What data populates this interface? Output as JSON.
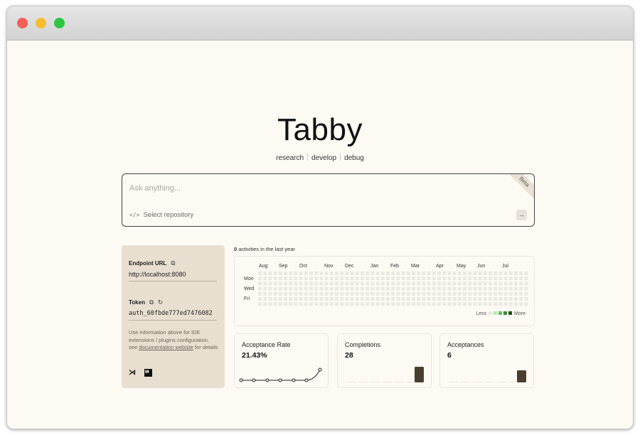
{
  "app": {
    "title": "Tabby"
  },
  "tagline": [
    "research",
    "develop",
    "debug"
  ],
  "ask": {
    "placeholder": "Ask anything...",
    "badge": "Beta",
    "repo_label": "Select repository"
  },
  "connection": {
    "endpoint_label": "Endpoint URL",
    "endpoint_value": "http://localhost:8080",
    "token_label": "Token",
    "token_value": "auth_60fbde777ed7476082",
    "info_text": "Use information above for IDE extensions / plugins configuration, see",
    "doc_link": "documentation website",
    "info_suffix": "for details",
    "ide_icons": [
      "vscode-icon",
      "jetbrains-icon"
    ]
  },
  "activity": {
    "count": "0",
    "count_label": "activities in the last year",
    "months": [
      "Aug",
      "Sep",
      "Oct",
      "Nov",
      "Dec",
      "Jan",
      "Feb",
      "Mar",
      "Apr",
      "May",
      "Jun",
      "Jul"
    ],
    "days": [
      "Mon",
      "Wed",
      "Fri"
    ],
    "legend_less": "Less",
    "legend_more": "More",
    "legend_colors": [
      "#ebe8e2",
      "#b8e6b0",
      "#5fc15a",
      "#3a8a3a",
      "#1f4e1f"
    ]
  },
  "stats": [
    {
      "title": "Acceptance Rate",
      "value": "21.43%",
      "kind": "line"
    },
    {
      "title": "Completions",
      "value": "28",
      "kind": "bar"
    },
    {
      "title": "Acceptances",
      "value": "6",
      "kind": "bar"
    }
  ],
  "colors": {
    "bg": "#fdfaf4",
    "panel": "#e8dfd0",
    "bar": "#4a3f2e"
  }
}
